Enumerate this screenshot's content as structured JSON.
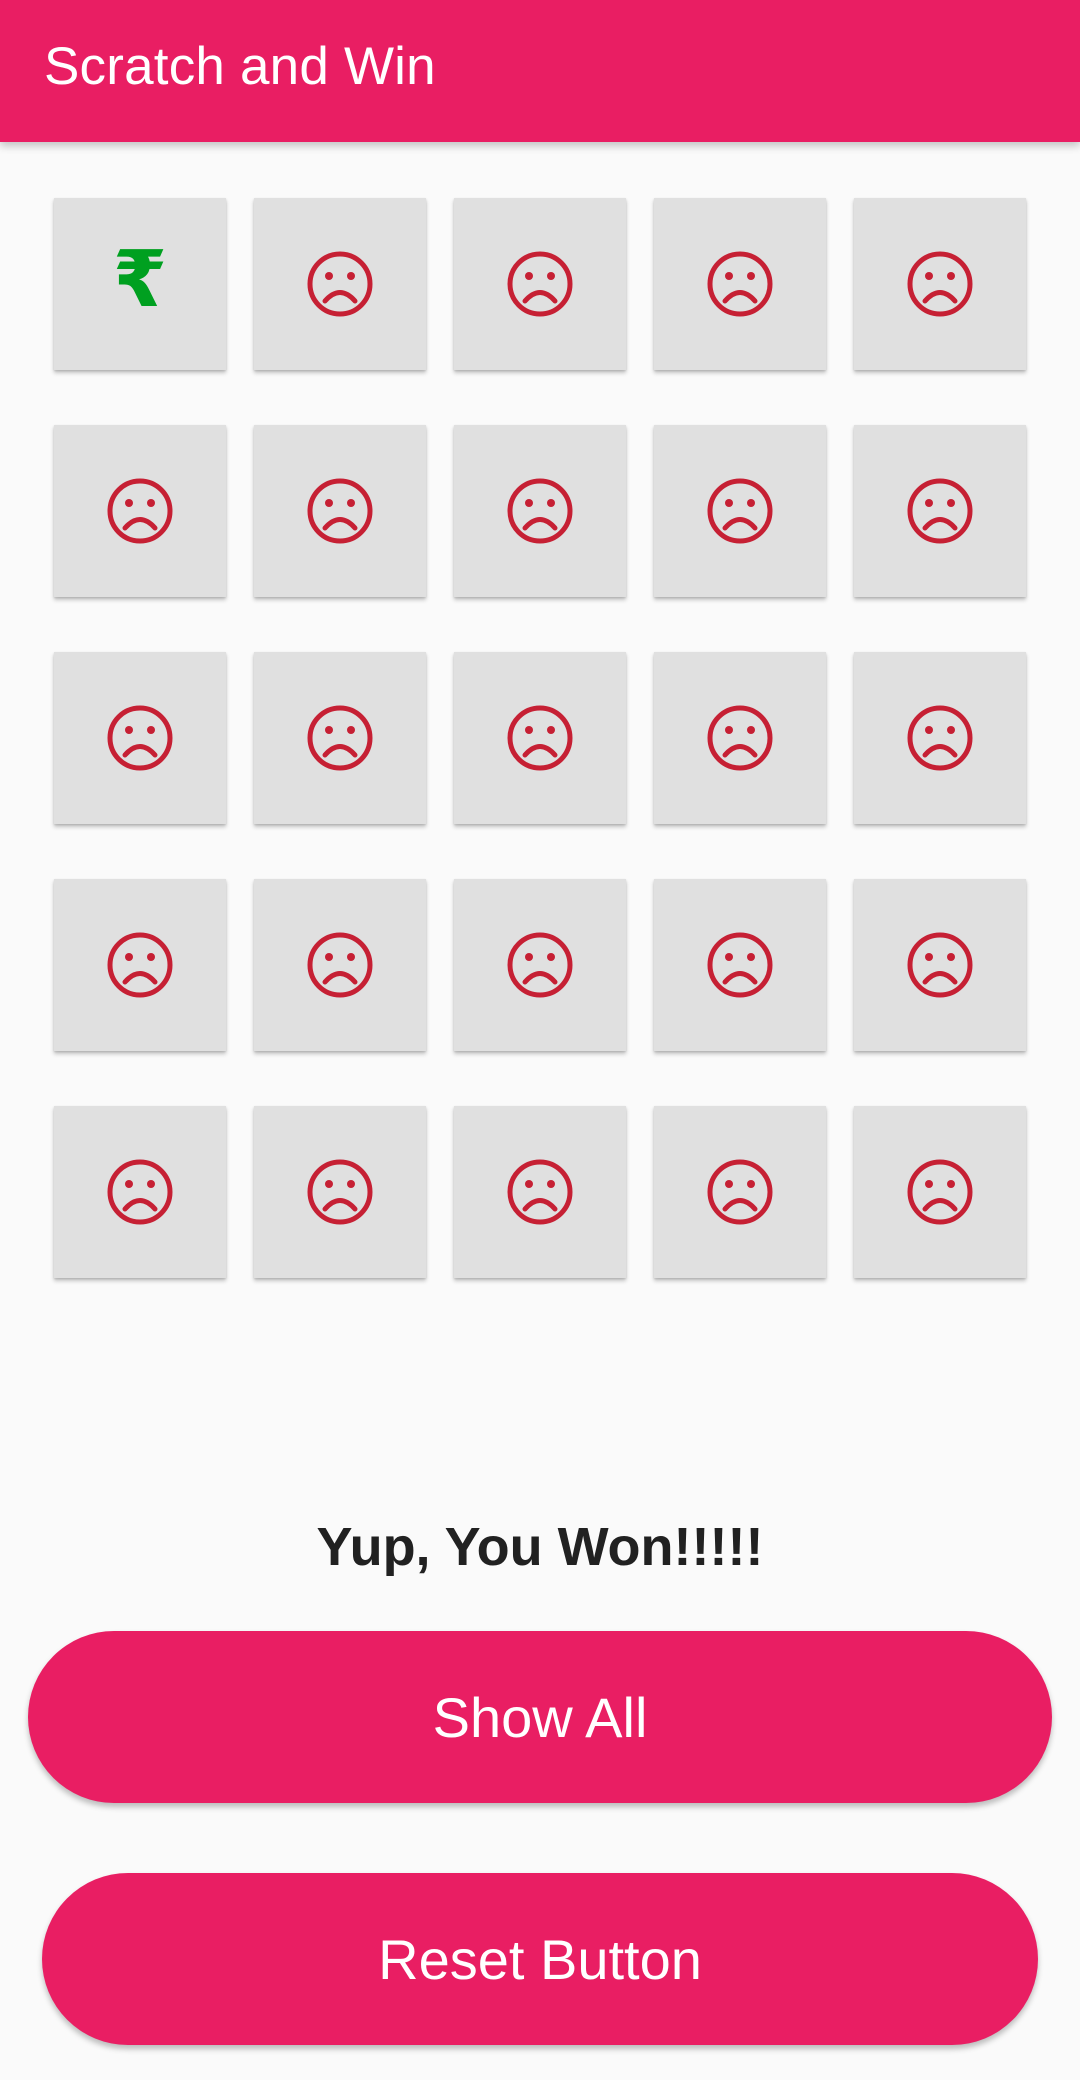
{
  "app_bar": {
    "title": "Scratch and Win",
    "color": "#e91e63"
  },
  "grid": {
    "rows": 5,
    "columns": 5,
    "tile_color": "#e0e0e0",
    "tiles": [
      {
        "icon": "rupee-icon",
        "glyph": "₹",
        "color": "#00a020"
      },
      {
        "icon": "sad-face-icon",
        "color": "#c62034"
      },
      {
        "icon": "sad-face-icon",
        "color": "#c62034"
      },
      {
        "icon": "sad-face-icon",
        "color": "#c62034"
      },
      {
        "icon": "sad-face-icon",
        "color": "#c62034"
      },
      {
        "icon": "sad-face-icon",
        "color": "#c62034"
      },
      {
        "icon": "sad-face-icon",
        "color": "#c62034"
      },
      {
        "icon": "sad-face-icon",
        "color": "#c62034"
      },
      {
        "icon": "sad-face-icon",
        "color": "#c62034"
      },
      {
        "icon": "sad-face-icon",
        "color": "#c62034"
      },
      {
        "icon": "sad-face-icon",
        "color": "#c62034"
      },
      {
        "icon": "sad-face-icon",
        "color": "#c62034"
      },
      {
        "icon": "sad-face-icon",
        "color": "#c62034"
      },
      {
        "icon": "sad-face-icon",
        "color": "#c62034"
      },
      {
        "icon": "sad-face-icon",
        "color": "#c62034"
      },
      {
        "icon": "sad-face-icon",
        "color": "#c62034"
      },
      {
        "icon": "sad-face-icon",
        "color": "#c62034"
      },
      {
        "icon": "sad-face-icon",
        "color": "#c62034"
      },
      {
        "icon": "sad-face-icon",
        "color": "#c62034"
      },
      {
        "icon": "sad-face-icon",
        "color": "#c62034"
      },
      {
        "icon": "sad-face-icon",
        "color": "#c62034"
      },
      {
        "icon": "sad-face-icon",
        "color": "#c62034"
      },
      {
        "icon": "sad-face-icon",
        "color": "#c62034"
      },
      {
        "icon": "sad-face-icon",
        "color": "#c62034"
      },
      {
        "icon": "sad-face-icon",
        "color": "#c62034"
      }
    ]
  },
  "result": {
    "text": "Yup, You Won!!!!!"
  },
  "buttons": {
    "show_all_label": "Show All",
    "reset_label": "Reset Button",
    "color": "#e91e63"
  }
}
